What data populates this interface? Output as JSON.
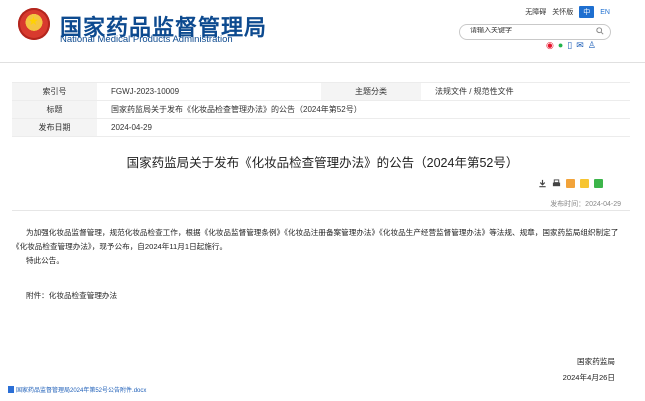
{
  "header": {
    "title_cn": "国家药品监督管理局",
    "title_en": "National Medical Products Administration",
    "nav": {
      "accessible": "无障碍",
      "care": "关怀版",
      "lang_zh": "中",
      "lang_en": "EN"
    },
    "search_placeholder": "请输入关键字"
  },
  "meta": {
    "index_label": "索引号",
    "index_value": "FGWJ-2023-10009",
    "category_label": "主题分类",
    "category_value": "法规文件 / 规范性文件",
    "title_label": "标题",
    "title_value": "国家药监局关于发布《化妆品检查管理办法》的公告（2024年第52号）",
    "date_label": "发布日期",
    "date_value": "2024-04-29"
  },
  "article": {
    "title": "国家药监局关于发布《化妆品检查管理办法》的公告（2024年第52号）",
    "pubtime": "发布时间：2024-04-29",
    "paragraph1": "为加强化妆品监督管理，规范化妆品检查工作，根据《化妆品监督管理条例》《化妆品注册备案管理办法》《化妆品生产经营监督管理办法》等法规、规章，国家药监局组织制定了《化妆品检查管理办法》，现予公布，自2024年11月1日起施行。",
    "paragraph2": "特此公告。",
    "attachment": "附件：化妆品检查管理办法",
    "signer": "国家药监局",
    "sign_date": "2024年4月26日",
    "file_link": "国家药品监督管理局2024年第52号公告附件.docx"
  },
  "colors": {
    "brand_blue": "#0d4a8f",
    "link_blue": "#1e5fb8"
  }
}
